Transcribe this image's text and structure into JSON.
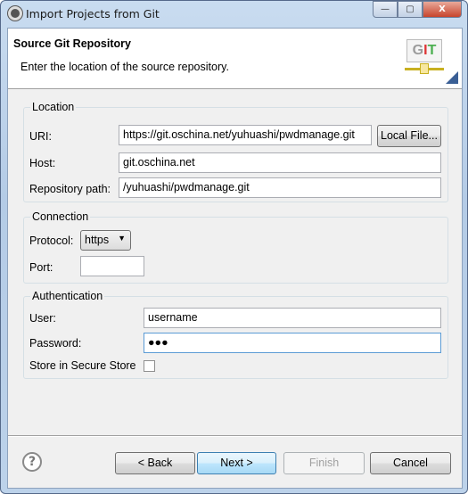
{
  "window": {
    "title": "Import Projects from Git",
    "minimize": "—",
    "maximize": "▢",
    "close": "X"
  },
  "header": {
    "title": "Source Git Repository",
    "description": "Enter the location of the source repository.",
    "logo_text": "GIT"
  },
  "location": {
    "group_label": "Location",
    "uri_label": "URI:",
    "uri_value": "https://git.oschina.net/yuhuashi/pwdmanage.git",
    "local_file_button": "Local File...",
    "host_label": "Host:",
    "host_value": "git.oschina.net",
    "path_label": "Repository path:",
    "path_value": "/yuhuashi/pwdmanage.git"
  },
  "connection": {
    "group_label": "Connection",
    "protocol_label": "Protocol:",
    "protocol_value": "https",
    "port_label": "Port:",
    "port_value": ""
  },
  "authentication": {
    "group_label": "Authentication",
    "user_label": "User:",
    "user_value": "username",
    "password_label": "Password:",
    "password_value": "●●●",
    "secure_store_label": "Store in Secure Store",
    "secure_store_checked": false
  },
  "buttons": {
    "help": "?",
    "back": "< Back",
    "next": "Next >",
    "finish": "Finish",
    "cancel": "Cancel"
  }
}
